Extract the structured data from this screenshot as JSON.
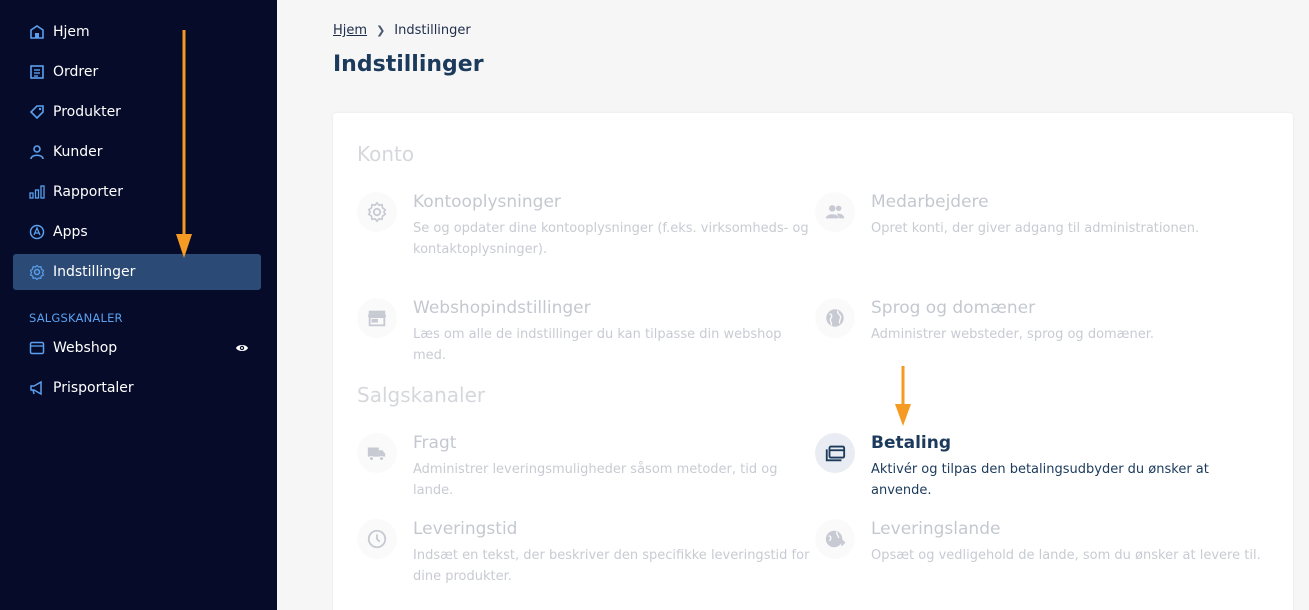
{
  "sidebar": {
    "items": [
      {
        "label": "Hjem",
        "icon": "home-icon"
      },
      {
        "label": "Ordrer",
        "icon": "orders-icon"
      },
      {
        "label": "Produkter",
        "icon": "tag-icon"
      },
      {
        "label": "Kunder",
        "icon": "user-icon"
      },
      {
        "label": "Rapporter",
        "icon": "bar-chart-icon"
      },
      {
        "label": "Apps",
        "icon": "apps-icon"
      },
      {
        "label": "Indstillinger",
        "icon": "gear-icon"
      }
    ],
    "section_label": "SALGSKANALER",
    "channels": [
      {
        "label": "Webshop",
        "icon": "store-icon"
      },
      {
        "label": "Prisportaler",
        "icon": "megaphone-icon"
      }
    ]
  },
  "breadcrumb": {
    "home": "Hjem",
    "current": "Indstillinger"
  },
  "page_title": "Indstillinger",
  "groups": {
    "konto": {
      "title": "Konto",
      "items": [
        {
          "title": "Kontooplysninger",
          "desc": "Se og opdater dine kontooplysninger (f.eks. virksomheds- og kontaktoplysninger).",
          "icon": "gear-icon"
        },
        {
          "title": "Medarbejdere",
          "desc": "Opret konti, der giver adgang til administrationen.",
          "icon": "people-icon"
        },
        {
          "title": "Webshopindstillinger",
          "desc": "Læs om alle de indstillinger du kan tilpasse din webshop med.",
          "icon": "store-icon"
        },
        {
          "title": "Sprog og domæner",
          "desc": "Administrer websteder, sprog og domæner.",
          "icon": "globe-icon"
        }
      ]
    },
    "salgskanaler": {
      "title": "Salgskanaler",
      "items": [
        {
          "title": "Fragt",
          "desc": "Administrer leveringsmuligheder såsom metoder, tid og lande.",
          "icon": "truck-icon"
        },
        {
          "title": "Betaling",
          "desc": "Aktivér og tilpas den betalingsudbyder du ønsker at anvende.",
          "icon": "payment-icon"
        },
        {
          "title": "Leveringstid",
          "desc": "Indsæt en tekst, der beskriver den specifikke leveringstid for dine produkter.",
          "icon": "clock-icon"
        },
        {
          "title": "Leveringslande",
          "desc": "Opsæt og vedligehold de lande, som du ønsker at levere til.",
          "icon": "globe-arrow-icon"
        }
      ]
    }
  },
  "colors": {
    "sidebar_bg": "#060b29",
    "active_nav": "#2b4a75",
    "arrow": "#f59a23",
    "title": "#1b3a5c"
  }
}
